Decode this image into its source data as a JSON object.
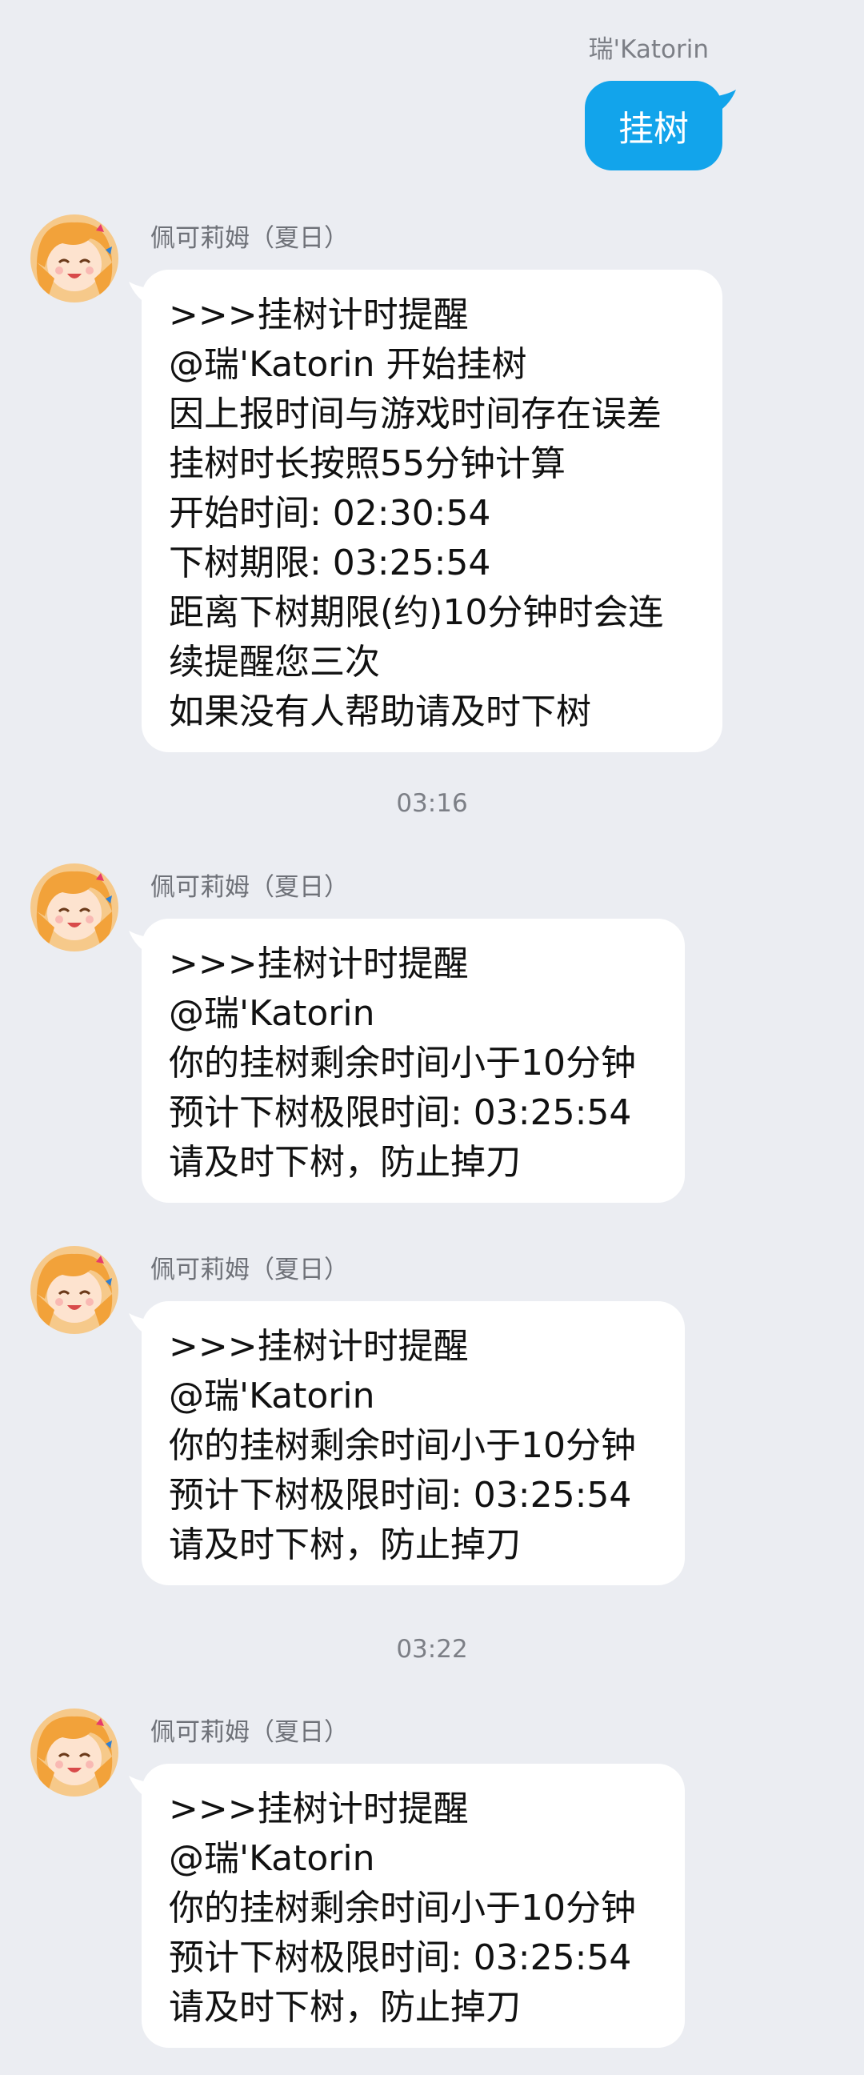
{
  "self_message": {
    "sender": "瑞'Katorin",
    "text": "挂树"
  },
  "messages": [
    {
      "sender": "佩可莉姆（夏日）",
      "lines": [
        ">>>挂树计时提醒",
        "@瑞'Katorin 开始挂树",
        "因上报时间与游戏时间存在误差",
        "挂树时长按照55分钟计算",
        "开始时间: 02:30:54",
        "下树期限: 03:25:54",
        "距离下树期限(约)10分钟时会连",
        "续提醒您三次",
        "如果没有人帮助请及时下树"
      ]
    },
    {
      "sender": "佩可莉姆（夏日）",
      "lines": [
        ">>>挂树计时提醒",
        "@瑞'Katorin",
        "你的挂树剩余时间小于10分钟",
        "预计下树极限时间: 03:25:54",
        "请及时下树，防止掉刀"
      ]
    },
    {
      "sender": "佩可莉姆（夏日）",
      "lines": [
        ">>>挂树计时提醒",
        "@瑞'Katorin",
        "你的挂树剩余时间小于10分钟",
        "预计下树极限时间: 03:25:54",
        "请及时下树，防止掉刀"
      ]
    },
    {
      "sender": "佩可莉姆（夏日）",
      "lines": [
        ">>>挂树计时提醒",
        "@瑞'Katorin",
        "你的挂树剩余时间小于10分钟",
        "预计下树极限时间: 03:25:54",
        "请及时下树，防止掉刀"
      ]
    }
  ],
  "timestamps": [
    "03:16",
    "03:22"
  ],
  "colors": {
    "background": "#ebedf2",
    "self_bubble": "#12a4eb",
    "other_bubble": "#ffffff"
  },
  "icons": {
    "avatar": "anime-girl-avatar"
  }
}
